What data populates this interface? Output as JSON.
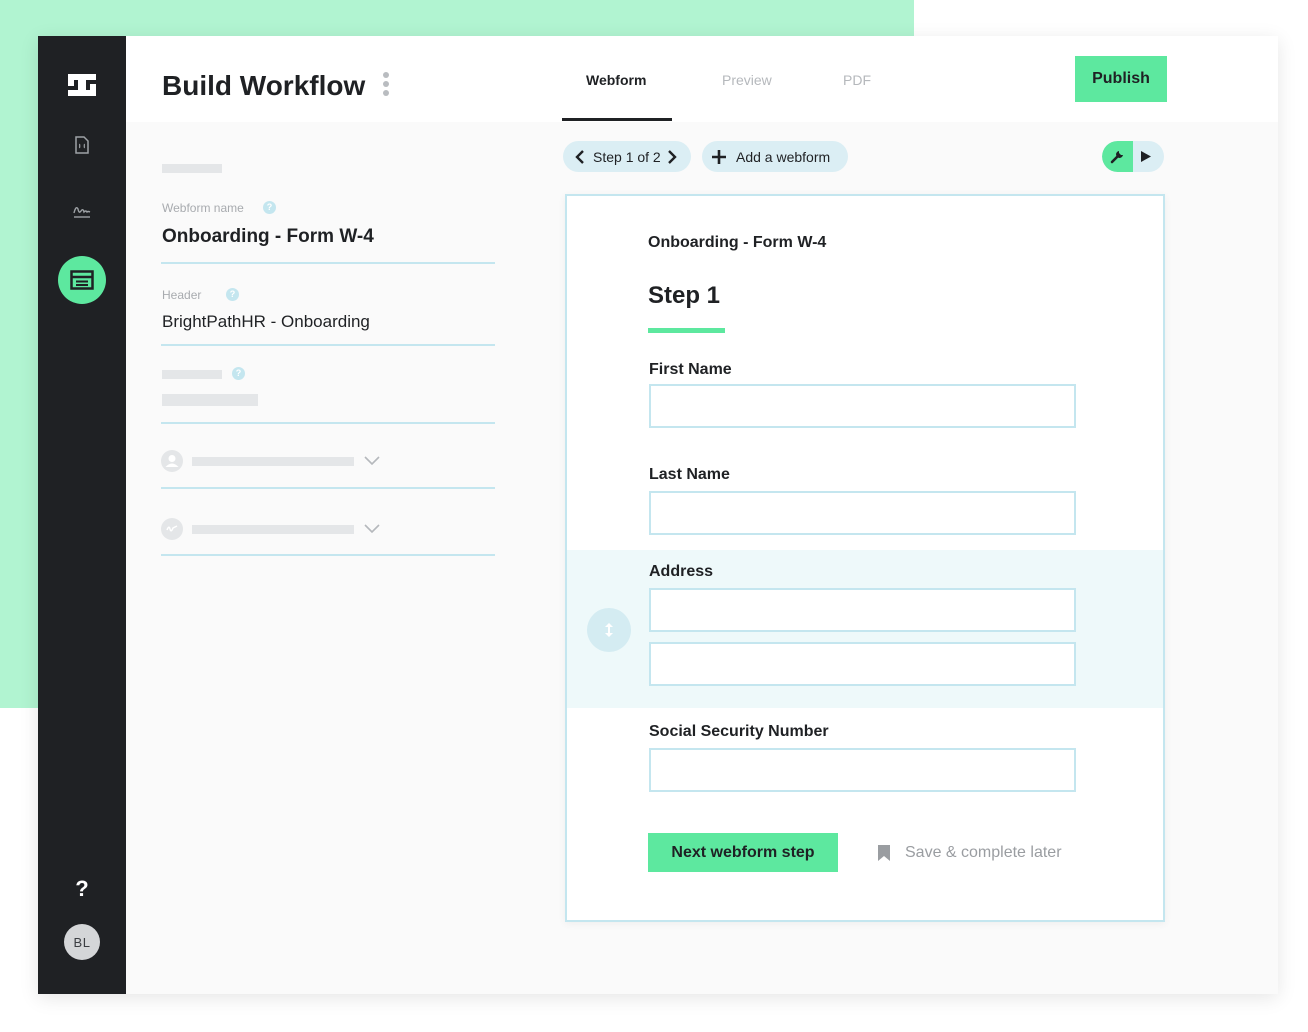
{
  "header": {
    "title": "Build Workflow",
    "tabs": [
      {
        "label": "Webform",
        "active": true
      },
      {
        "label": "Preview",
        "active": false
      },
      {
        "label": "PDF",
        "active": false
      }
    ],
    "publish_label": "Publish"
  },
  "sidebar": {
    "help_label": "?",
    "avatar_initials": "BL",
    "active_item_icon": "webform-icon"
  },
  "settings": {
    "webform_name_label": "Webform name",
    "webform_name_value": "Onboarding  - Form W-4",
    "header_label": "Header",
    "header_value": "BrightPathHR - Onboarding",
    "info_glyph": "?"
  },
  "toolbar": {
    "step_label": "Step 1 of 2",
    "add_webform_label": "Add a webform"
  },
  "form": {
    "subtitle": "Onboarding - Form W-4",
    "step_title": "Step 1",
    "fields": [
      {
        "label": "First Name"
      },
      {
        "label": "Last Name"
      },
      {
        "label": "Address"
      },
      {
        "label": "Social Security Number"
      }
    ],
    "next_label": "Next webform step",
    "save_later_label": "Save & complete later"
  },
  "colors": {
    "accent": "#5de89f",
    "mint_background": "#b1f4d1",
    "rail": "#1f2124",
    "border": "#c4e6ef"
  }
}
